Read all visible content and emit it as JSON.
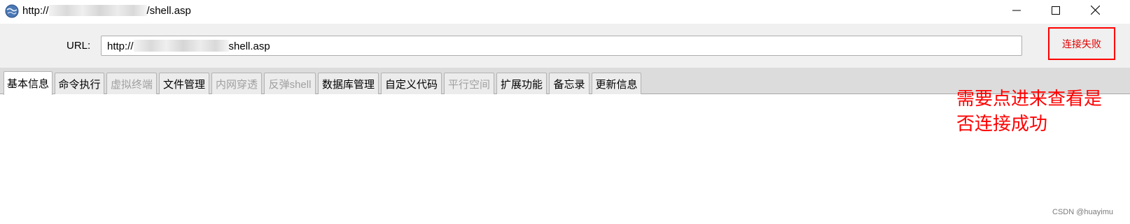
{
  "window": {
    "title_prefix": "http://",
    "title_suffix": "/shell.asp",
    "app_icon": "app-globe-icon",
    "controls": {
      "minimize": "minimize-icon",
      "maximize": "maximize-icon",
      "close": "close-icon"
    }
  },
  "url_bar": {
    "label": "URL:",
    "value_prefix": "http://",
    "value_suffix": "shell.asp",
    "status_label": "连接失败",
    "status_color": "#ff0000"
  },
  "tabs": [
    {
      "label": "基本信息",
      "state": "active"
    },
    {
      "label": "命令执行",
      "state": "enabled"
    },
    {
      "label": "虚拟终端",
      "state": "disabled"
    },
    {
      "label": "文件管理",
      "state": "enabled"
    },
    {
      "label": "内网穿透",
      "state": "disabled"
    },
    {
      "label": "反弹shell",
      "state": "disabled"
    },
    {
      "label": "数据库管理",
      "state": "enabled"
    },
    {
      "label": "自定义代码",
      "state": "enabled"
    },
    {
      "label": "平行空间",
      "state": "disabled"
    },
    {
      "label": "扩展功能",
      "state": "enabled"
    },
    {
      "label": "备忘录",
      "state": "enabled"
    },
    {
      "label": "更新信息",
      "state": "enabled"
    }
  ],
  "annotation": {
    "text": "需要点进来查看是否连接成功",
    "color": "#ff0000"
  },
  "watermark": "CSDN @huayimu"
}
